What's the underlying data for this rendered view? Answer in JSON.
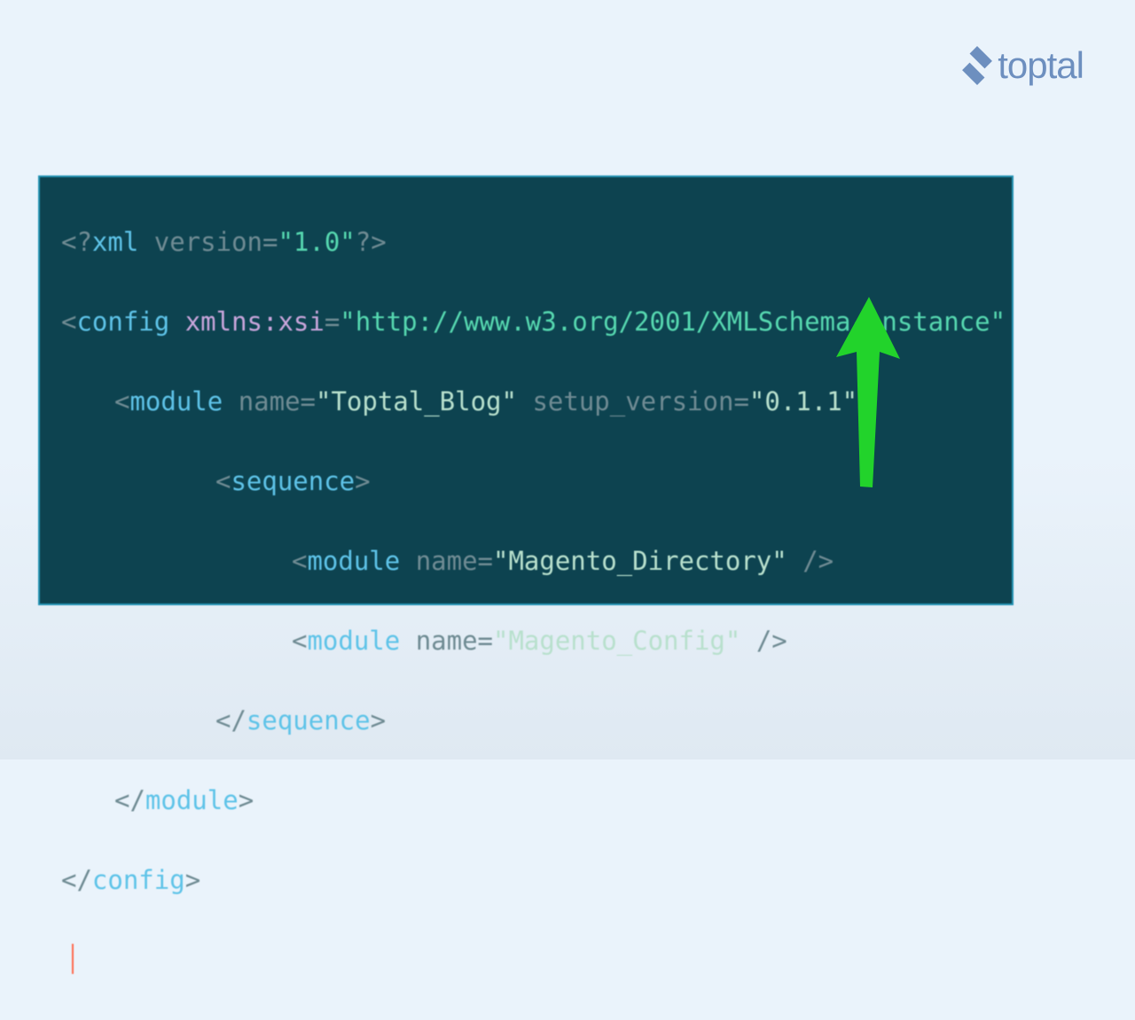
{
  "brand": {
    "name": "toptal"
  },
  "code": {
    "l1": {
      "a": "<?",
      "b": "xml ",
      "c": "version",
      "d": "=",
      "e": "\"1.0\"",
      "f": "?>"
    },
    "l2": {
      "a": "<",
      "b": "config ",
      "c": "xmlns:xsi",
      "d": "=",
      "e": "\"http://www.w3.org/2001/XMLSchema-instance\""
    },
    "l3": {
      "a": "<",
      "b": "module ",
      "c": "name",
      "d": "=",
      "e": "\"Toptal_Blog\"",
      "f": " ",
      "g": "setup_version",
      "h": "=",
      "i": "\"0.1.1\"",
      "j": ">"
    },
    "l4": {
      "a": "<",
      "b": "sequence",
      "c": ">"
    },
    "l5": {
      "a": "<",
      "b": "module ",
      "c": "name",
      "d": "=",
      "e": "\"Magento_Directory\"",
      "f": " />"
    },
    "l6": {
      "a": "<",
      "b": "module ",
      "c": "name",
      "d": "=",
      "e": "\"Magento_Config\"",
      "f": " />"
    },
    "l7": {
      "a": "</",
      "b": "sequence",
      "c": ">"
    },
    "l8": {
      "a": "</",
      "b": "module",
      "c": ">"
    },
    "l9": {
      "a": "</",
      "b": "config",
      "c": ">"
    }
  }
}
